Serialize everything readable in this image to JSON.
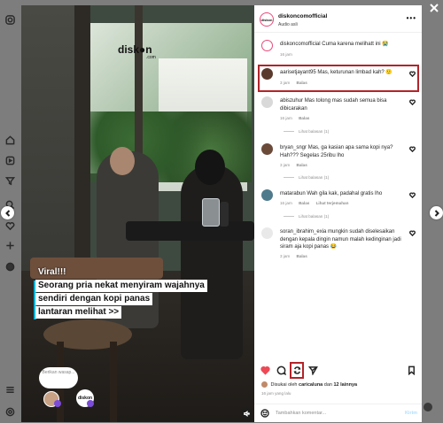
{
  "post": {
    "username": "diskoncomofficial",
    "audio": "Audio asli",
    "avatar_text": "diskon"
  },
  "media": {
    "brand": "disk●n",
    "brand_sub": ".com",
    "caption_lines": [
      "Viral!!!",
      "Seorang pria nekat menyiram wajahnya",
      "sendiri dengan kopi panas",
      "lantaran melihat >>"
    ],
    "bubble_text": "Berikan wasap...",
    "avatar_b_text": "diskon"
  },
  "comments": [
    {
      "user": "diskoncomofficial",
      "text": "Cuma karena melihatt ini 😭",
      "meta": [
        "16 jam"
      ],
      "avatar_color": "#ffffff"
    },
    {
      "user": "aarisetjayant95",
      "text": "Mas, keturunan limbad kah? 🙂",
      "meta": [
        "3 jam",
        "Balas"
      ],
      "avatar_color": "#5b3a2e"
    },
    {
      "user": "abiszuhur",
      "text": "Mas tolong mas sudah semua bisa dibicarakan",
      "meta": [
        "16 jam",
        "Balas"
      ],
      "replies": "Lihat balasan (1)",
      "avatar_color": "#d9d9d9"
    },
    {
      "user": "bryan_sngr",
      "text": "Mas, ga kasian apa sama kopi nya? Hah??? Segelas 25ribu lho",
      "meta": [
        "3 jam",
        "Balas"
      ],
      "replies": "Lihat balasan (1)",
      "avatar_color": "#6b4a3a"
    },
    {
      "user": "matarabun",
      "text": "Wah gila kak, padahal gratis lho",
      "meta": [
        "16 jam",
        "Balas",
        "Lihat terjemahan"
      ],
      "replies": "Lihat balasan (1)",
      "avatar_color": "#4f7a8c"
    },
    {
      "user": "soran_ibrahim_exia",
      "text": "mungkin sudah diselesaikan dengan kepala dingin namun malah kedinginan jadi siram aja kopi panas 😂",
      "meta": [
        "3 jam",
        "Balas"
      ],
      "avatar_color": "#e9e9e9"
    }
  ],
  "actions": {
    "likes_prefix": "Disukai oleh",
    "liked_by": "caricaluna",
    "likes_conj": "dan",
    "likes_others": "12 lainnya",
    "posted": "16 jam yang lalu"
  },
  "add_comment": {
    "placeholder": "Tambahkan komentar...",
    "post_label": "Kirim"
  },
  "colors": {
    "highlight": "#b3242a",
    "like_heart": "#ed4956",
    "caption_accent": "#00b3d8"
  },
  "icons": {
    "left_rail": [
      "instagram-icon",
      "home-icon",
      "reels-icon",
      "filter-icon",
      "search-icon",
      "heart-icon",
      "plus-icon",
      "profile-icon",
      "menu-icon",
      "threads-icon"
    ]
  }
}
